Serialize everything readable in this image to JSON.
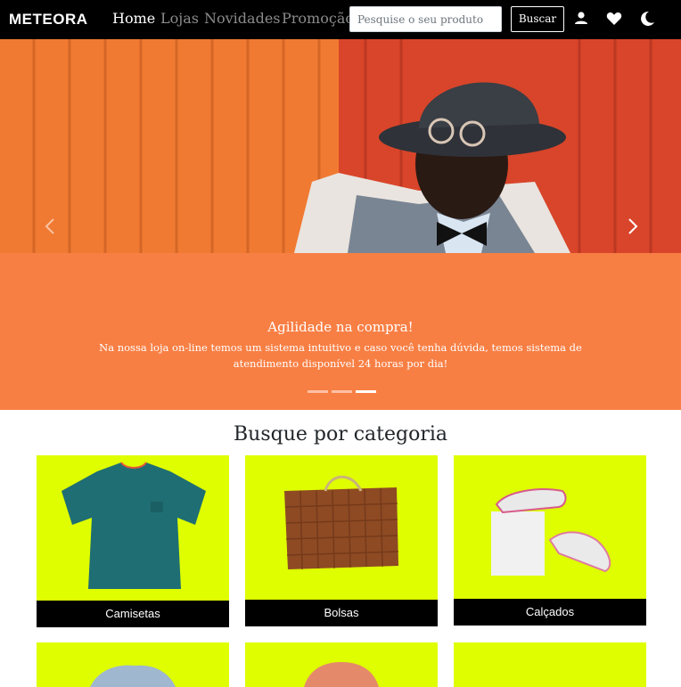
{
  "brand": {
    "logo_text": "METEORA"
  },
  "nav": {
    "links": [
      {
        "label": "Home",
        "active": true
      },
      {
        "label": "Lojas",
        "active": false
      },
      {
        "label": "Novidades",
        "active": false
      },
      {
        "label": "Promoção",
        "active": false
      }
    ],
    "search_placeholder": "Pesquise o seu produto",
    "search_button": "Buscar",
    "icons": [
      "user-icon",
      "heart-icon",
      "moon-icon"
    ]
  },
  "hero": {
    "title": "Agilidade na compra!",
    "text": "Na nossa loja on-line temos um sistema intuitivo e caso você tenha dúvida, temos sistema de atendimento disponível 24 horas por dia!",
    "slide_count": 3,
    "active_slide": 3,
    "colors": {
      "band": "#f87f44",
      "photo_bg": "#e4552e"
    }
  },
  "categories": {
    "heading": "Busque por categoria",
    "items": [
      {
        "label": "Camisetas",
        "icon": "tshirt-image"
      },
      {
        "label": "Bolsas",
        "icon": "handbag-image"
      },
      {
        "label": "Calçados",
        "icon": "sneakers-image"
      },
      {
        "label": "",
        "icon": "jacket-image"
      },
      {
        "label": "",
        "icon": "blouse-image"
      },
      {
        "label": "",
        "icon": "blank-image"
      }
    ],
    "card_color": "#dfff00"
  }
}
